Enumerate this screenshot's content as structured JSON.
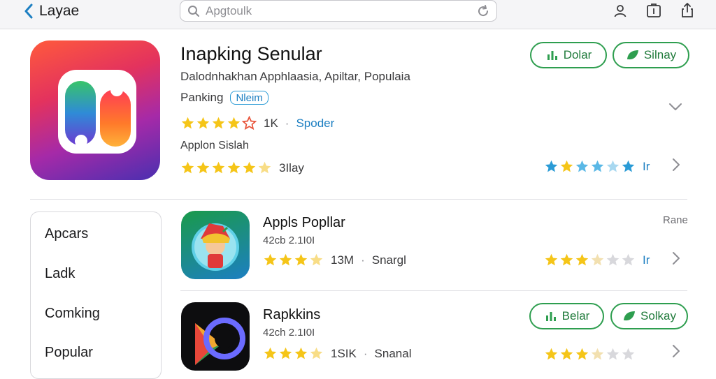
{
  "topbar": {
    "back_label": "Layae",
    "search_placeholder": "Apgtoulk"
  },
  "hero": {
    "title": "Inapking Senular",
    "subtitle": "Dalodnhakhan Apphlaasia, Apiltar, Populaia",
    "rank_label": "Panking",
    "badge": "Nleim",
    "rating_count": "1K",
    "separator": "·",
    "link_text": "Spoder",
    "caption": "Applon Sislah",
    "rating2_value": "3Ilay",
    "right_rating_label": "Ir",
    "buttons": [
      {
        "label": "Dolar",
        "icon": "chart-icon"
      },
      {
        "label": "Silnay",
        "icon": "leaf-icon"
      }
    ]
  },
  "sidemenu": {
    "items": [
      "Apcars",
      "Ladk",
      "Comking",
      "Popular"
    ]
  },
  "list": {
    "section_right_label": "Rane",
    "rows": [
      {
        "title": "Appls Popllar",
        "meta": "42cb 2.1I0I",
        "count": "13M",
        "separator": "·",
        "tag": "Snargl",
        "right_label": "Ir"
      },
      {
        "title": "Rapkkins",
        "meta": "42ch 2.1I0I",
        "count": "1SIK",
        "separator": "·",
        "tag": "Snanal",
        "buttons": [
          {
            "label": "Belar",
            "icon": "chart-icon"
          },
          {
            "label": "Solkay",
            "icon": "leaf-icon"
          }
        ]
      }
    ]
  },
  "colors": {
    "accent_blue": "#1d7fc2",
    "accent_green": "#2e9e4f",
    "star_gold": "#f5c518",
    "star_blue": "#2a9bd6"
  }
}
